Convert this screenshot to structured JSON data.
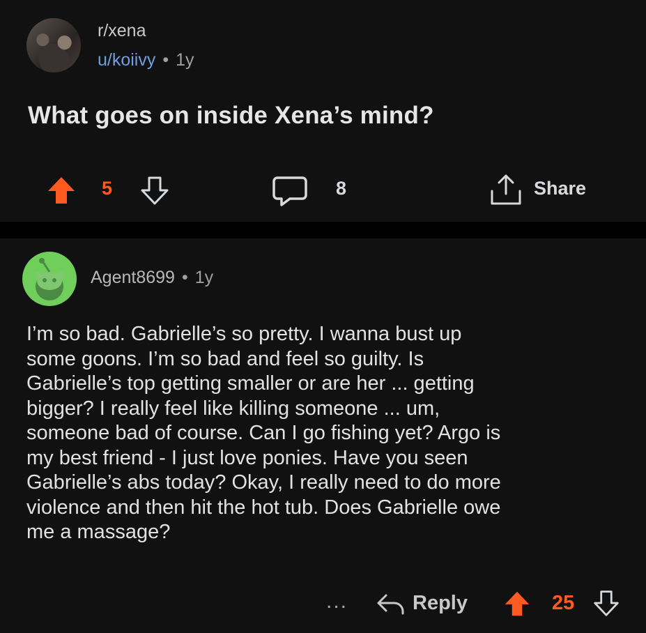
{
  "post": {
    "subreddit": "r/xena",
    "author": "u/koiivy",
    "separator": "•",
    "age": "1y",
    "title": "What goes on inside Xena’s mind?",
    "score": "5",
    "comment_count": "8",
    "share_label": "Share"
  },
  "comment": {
    "author": "Agent8699",
    "separator": "•",
    "age": "1y",
    "body_lines": [
      "I’m so bad. Gabrielle’s so pretty. I wanna bust up",
      "some goons. I’m so bad and feel so guilty. Is",
      "Gabrielle’s top getting smaller or are her ... getting",
      "bigger? I really feel like killing someone ... um,",
      "someone bad of course. Can I go fishing yet? Argo is",
      "my best friend - I just love ponies. Have you seen",
      "Gabrielle’s abs today? Okay, I really need to do more",
      "violence and then hit the hot tub. Does Gabrielle owe",
      "me a massage?"
    ],
    "more_label": "...",
    "reply_label": "Reply",
    "score": "25"
  },
  "colors": {
    "upvote": "#ff5a1f",
    "username_link": "#6f9fdc",
    "avatar_green": "#6fcf5a",
    "background": "#111112"
  },
  "icons": [
    "upvote-arrow-icon",
    "downvote-arrow-icon",
    "comment-bubble-icon",
    "share-icon",
    "reply-arrow-icon",
    "snoo-avatar-icon"
  ]
}
